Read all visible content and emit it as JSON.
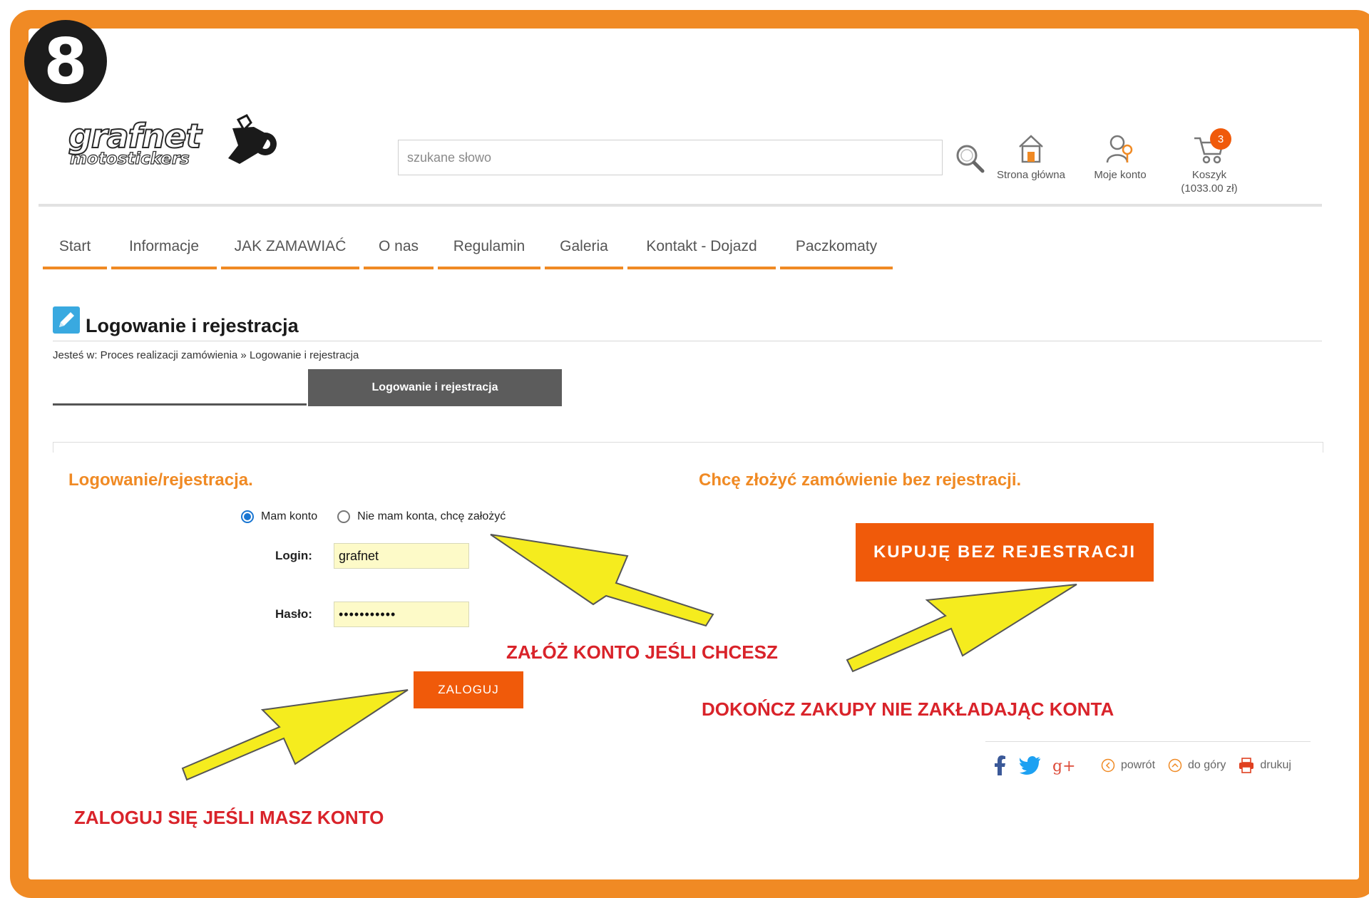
{
  "step_badge": "8",
  "logo": {
    "line1": "grafnet",
    "line2": "motostickers"
  },
  "search": {
    "placeholder": "szukane słowo"
  },
  "top_links": {
    "home": "Strona główna",
    "account": "Moje konto",
    "cart": "Koszyk",
    "cart_total": "(1033.00 zł)",
    "cart_count": "3"
  },
  "nav": [
    "Start",
    "Informacje",
    "JAK ZAMAWIAĆ",
    "O nas",
    "Regulamin",
    "Galeria",
    "Kontakt - Dojazd",
    "Paczkomaty"
  ],
  "page": {
    "title": "Logowanie i rejestracja",
    "breadcrumb": "Jesteś w: Proces realizacji zamówienia » Logowanie i rejestracja",
    "tab": "Logowanie i rejestracja"
  },
  "login_section": {
    "title": "Logowanie/rejestracja.",
    "radio_have_account": "Mam konto",
    "radio_no_account": "Nie mam konta, chcę założyć",
    "login_label": "Login:",
    "login_value": "grafnet",
    "password_label": "Hasło:",
    "password_value": "•••••••••••",
    "login_button": "ZALOGUJ"
  },
  "guest_section": {
    "title": "Chcę złożyć zamówienie bez rejestracji.",
    "button": "KUPUJĘ BEZ REJESTRACJI"
  },
  "annotations": {
    "create_account": "ZAŁÓŻ KONTO JEŚLI CHCESZ",
    "finish_without_account": "DOKOŃCZ ZAKUPY NIE ZAKŁADAJĄC KONTA",
    "login_if_account": "ZALOGUJ SIĘ JEŚLI MASZ KONTO"
  },
  "footer_tools": {
    "back": "powrót",
    "top": "do góry",
    "print": "drukuj"
  },
  "colors": {
    "frame": "#f08a24",
    "button": "#f05a0a",
    "annotation": "#d9232a",
    "arrow": "#f5ec1e"
  }
}
